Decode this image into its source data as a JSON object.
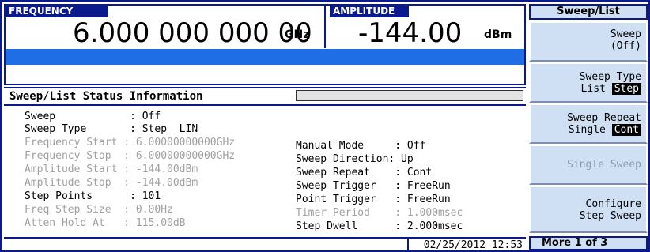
{
  "frequency": {
    "label": "FREQUENCY",
    "value": "6.000 000 000 00",
    "unit": "GHz"
  },
  "amplitude": {
    "label": "AMPLITUDE",
    "value": "-144.00",
    "unit": "dBm"
  },
  "status": {
    "title": "Sweep/List Status Information",
    "progress_fraction": 0,
    "left_rows": [
      {
        "label": "Sweep            ",
        "value": ": Off",
        "dim": false
      },
      {
        "label": "Sweep Type       ",
        "value": ": Step  LIN",
        "dim": false
      },
      {
        "label": "Frequency Start ",
        "value": ": 6.00000000000GHz",
        "dim": true
      },
      {
        "label": "Frequency Stop  ",
        "value": ": 6.00000000000GHz",
        "dim": true
      },
      {
        "label": "Amplitude Start ",
        "value": ": -144.00dBm",
        "dim": true
      },
      {
        "label": "Amplitude Stop  ",
        "value": ": -144.00dBm",
        "dim": true
      },
      {
        "label": "Step Points      ",
        "value": ": 101",
        "dim": false
      },
      {
        "label": "Freq Step Size  ",
        "value": ": 0.00Hz",
        "dim": true
      },
      {
        "label": "Atten Hold At   ",
        "value": ": 115.00dB",
        "dim": true
      }
    ],
    "right_rows": [
      {
        "label": "Manual Mode     ",
        "value": ": Off",
        "dim": false
      },
      {
        "label": "Sweep Direction",
        "value": ": Up",
        "dim": false
      },
      {
        "label": "Sweep Repeat    ",
        "value": ": Cont",
        "dim": false
      },
      {
        "label": "Sweep Trigger   ",
        "value": ": FreeRun",
        "dim": false
      },
      {
        "label": "Point Trigger   ",
        "value": ": FreeRun",
        "dim": false
      },
      {
        "label": "Timer Period    ",
        "value": ": 1.000msec",
        "dim": true
      },
      {
        "label": "Step Dwell      ",
        "value": ": 2.000msec",
        "dim": false
      }
    ],
    "timestamp": "02/25/2012 12:53"
  },
  "softkeys": {
    "title": "Sweep/List",
    "sweep": {
      "line1": "Sweep",
      "line2": "(Off)"
    },
    "sweep_type": {
      "line1": "Sweep Type",
      "line2_prefix": "List",
      "line2_selected": "Step"
    },
    "sweep_repeat": {
      "line1": "Sweep Repeat",
      "line2_prefix": "Single",
      "line2_selected": "Cont"
    },
    "single_sweep": {
      "line1": "Single Sweep"
    },
    "configure_step": {
      "line1": "Configure",
      "line2": "Step Sweep"
    },
    "more": "More 1 of 3"
  },
  "colors": {
    "frame_blue": "#0a1a8c",
    "bar_blue": "#1f6ee6",
    "softkey_bg": "#cfe0f5",
    "dim_text": "#a0a0a0"
  }
}
